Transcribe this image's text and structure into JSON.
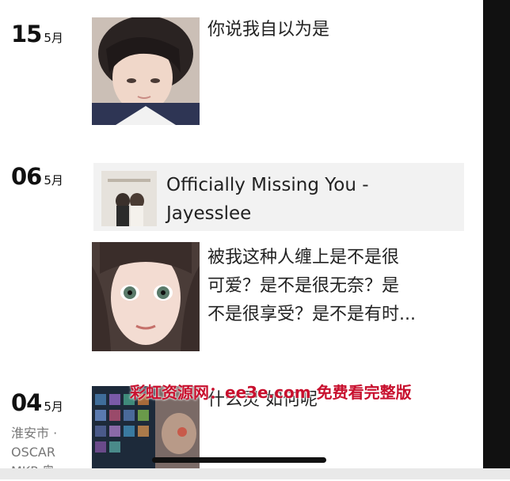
{
  "moments": [
    {
      "day": "15",
      "month": "5月",
      "text": "你说我自以为是"
    },
    {
      "day": "06",
      "month": "5月",
      "music": {
        "title": "Officially Missing You -",
        "artist": "Jayesslee"
      },
      "text_lines": [
        "被我这种人缠上是不是很",
        "可爱？是不是很无奈？是",
        "不是很享受？是不是有时..."
      ]
    },
    {
      "day": "04",
      "month": "5月",
      "text": "什么灵 如何呢",
      "location_lines": [
        "淮安市 ·",
        "OSCAR",
        "MKP 奥"
      ]
    }
  ],
  "watermark": "彩虹资源网：ee3e.com 免费看完整版",
  "colors": {
    "watermark": "#c8102e",
    "card_bg": "#f2f2f2",
    "location": "#777777"
  }
}
